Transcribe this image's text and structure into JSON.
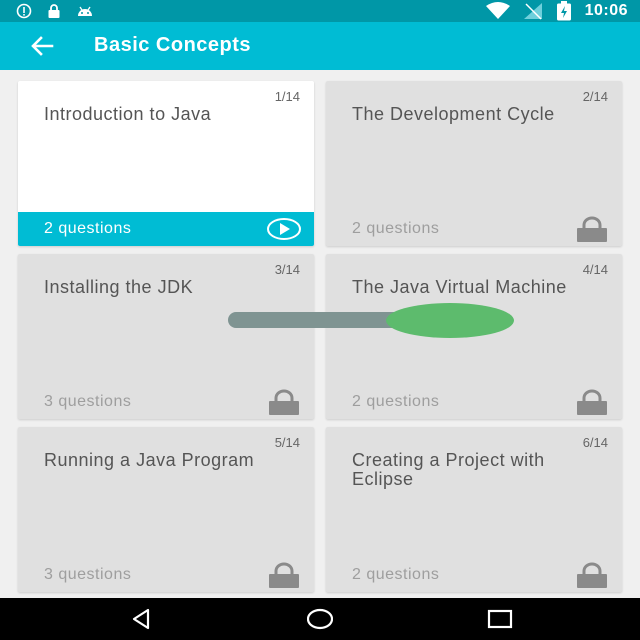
{
  "status_bar": {
    "time": "10:06",
    "left_icons": [
      "info-icon",
      "lock-icon",
      "android-icon"
    ],
    "right_icons": [
      "wifi-icon",
      "signal-icon",
      "battery-icon"
    ]
  },
  "app_bar": {
    "title": "Basic Concepts",
    "back_icon": "arrow-left-icon"
  },
  "cards": [
    {
      "title": "Introduction to Java",
      "counter": "1/14",
      "questions": "2 questions",
      "state": "unlocked",
      "icon": "play-icon"
    },
    {
      "title": "The Development Cycle",
      "counter": "2/14",
      "questions": "2 questions",
      "state": "locked",
      "icon": "lock-icon"
    },
    {
      "title": "Installing the JDK",
      "counter": "3/14",
      "questions": "3 questions",
      "state": "locked",
      "icon": "lock-icon"
    },
    {
      "title": "The Java Virtual Machine",
      "counter": "4/14",
      "questions": "2 questions",
      "state": "locked",
      "icon": "lock-icon"
    },
    {
      "title": "Running a Java Program",
      "counter": "5/14",
      "questions": "3 questions",
      "state": "locked",
      "icon": "lock-icon"
    },
    {
      "title": "Creating a Project with Eclipse",
      "counter": "6/14",
      "questions": "2 questions",
      "state": "locked",
      "icon": "lock-icon"
    }
  ],
  "colors": {
    "primary": "#00bcd4",
    "primary_dark": "#0097a7",
    "card_locked": "#e0e0e0",
    "card_active": "#ffffff"
  },
  "nav_bar": {
    "icons": [
      "back-triangle-icon",
      "home-circle-icon",
      "recents-square-icon"
    ]
  }
}
